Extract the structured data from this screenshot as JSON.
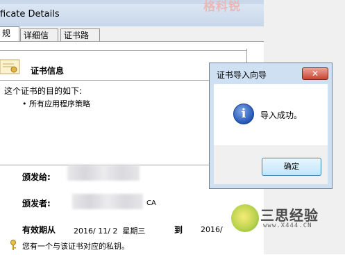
{
  "window": {
    "title": "ficate Details",
    "tabs": [
      "规",
      "详细信息",
      "证书路径"
    ]
  },
  "general": {
    "section_title": "证书信息",
    "purpose_heading": "这个证书的目的如下:",
    "purpose_items": [
      "• 所有应用程序策略"
    ],
    "issued_to_label": "颁发给:",
    "issued_by_label": "颁发者:",
    "issued_by_suffix": "CA",
    "valid_label": "有效期从",
    "valid_from": "2016/ 11/ 2  星期三",
    "valid_to_label": "到",
    "valid_to": "2016/",
    "private_key_note": "您有一个与该证书对应的私钥。"
  },
  "wizard": {
    "title": "证书导入向导",
    "close_label": "✕",
    "message": "导入成功。",
    "ok_label": "确定"
  },
  "watermark": {
    "top_text": "格科锐",
    "logo_text": "三思经验",
    "logo_url": "www.X444.CN"
  }
}
